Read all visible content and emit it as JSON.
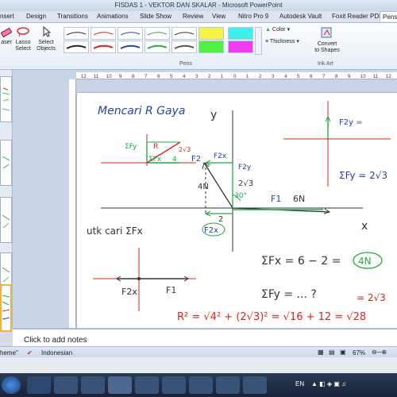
{
  "window": {
    "title": "FISDAS 1 - VEKTOR DAN SKALAR - Microsoft PowerPoint"
  },
  "tabs": [
    "nsert",
    "Design",
    "Transitions",
    "Animations",
    "Slide Show",
    "Review",
    "View",
    "Nitro Pro 9",
    "Autodesk Vault",
    "Foxit Reader PDF",
    "Pens"
  ],
  "ribbon": {
    "eraser_label": "aser",
    "lasso_label": "Lasso",
    "lasso_label2": "Select",
    "select_label": "Select",
    "select_label2": "Objects",
    "color_label": "Color",
    "thickness_label": "Thickness",
    "convert_label": "Convert",
    "convert_label2": "to Shapes",
    "pens_group": "Pens",
    "inkart_group": "Ink Art"
  },
  "ruler": {
    "ticks": [
      "12",
      "11",
      "10",
      "9",
      "8",
      "7",
      "6",
      "5",
      "4",
      "3",
      "2",
      "1",
      "0",
      "1",
      "2",
      "3",
      "4",
      "5",
      "6",
      "7",
      "8",
      "9",
      "10",
      "11",
      "12"
    ]
  },
  "slide": {
    "heading": "Mencari R Gaya",
    "y_label": "y",
    "x_label": "x",
    "f2": "F2",
    "f2x_top": "F2x",
    "f2y": "F2y",
    "two_root3": "2√3",
    "four_n": "4N",
    "thirty": "30°",
    "f1": "F1",
    "six_n": "6N",
    "two": "2",
    "f2x": "F2x",
    "sum_fy_small": "ΣFy",
    "r_small": "R",
    "two_root3_small": "2√3",
    "sum_fx_small": "ΣFx",
    "four_small": "4",
    "untuk": "utk cari ΣFx",
    "f2x_line": "F2x",
    "f1_line": "F1",
    "sum_fx_eq": "ΣFx = 6 − 2 =",
    "four_n_circle": "4N",
    "sum_fy_eq": "ΣFy = ... ?",
    "sum_fy_ans": "= 2√3",
    "f2y_right": "F2y =",
    "sum_fy_right": "ΣFy = 2√3",
    "r_eq": "R² = √4² + (2√3)² = √16 + 12 = √28"
  },
  "notes": {
    "placeholder": "Click to add notes"
  },
  "status": {
    "theme": "heme\"",
    "language": "Indonesian",
    "zoom": "67%"
  },
  "taskbar": {
    "lang": "EN"
  }
}
